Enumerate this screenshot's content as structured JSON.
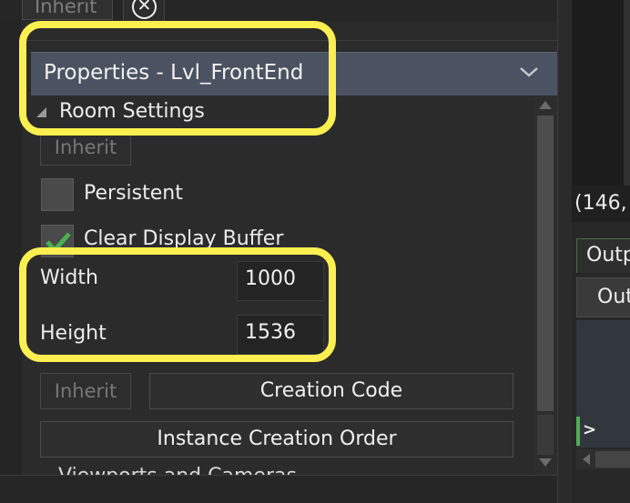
{
  "top": {
    "inherit_label": "Inherit",
    "close_glyph": "⊗"
  },
  "panel": {
    "title": "Properties - Lvl_FrontEnd",
    "chevron_icon": "chevron-down-icon",
    "section_title": "Room Settings",
    "inherit_label_1": "Inherit",
    "persistent": {
      "label": "Persistent",
      "checked": false
    },
    "clear_display_buffer": {
      "label": "Clear Display Buffer",
      "checked": true
    },
    "width": {
      "label": "Width",
      "value": "1000"
    },
    "height": {
      "label": "Height",
      "value": "1536"
    },
    "inherit_label_2": "Inherit",
    "creation_code_label": "Creation Code",
    "instance_order_label": "Instance Creation Order",
    "partial_next_label": "Viewports and Cameras"
  },
  "right": {
    "coords": "(146,",
    "output_tab_label": "Output",
    "output_button_label": "Output",
    "console_prompt": ">"
  },
  "colors": {
    "highlight": "#fcef50",
    "header_bg": "#4b5261",
    "checkbox_check": "#4caf50",
    "panel_bg": "#2b2b2b"
  }
}
